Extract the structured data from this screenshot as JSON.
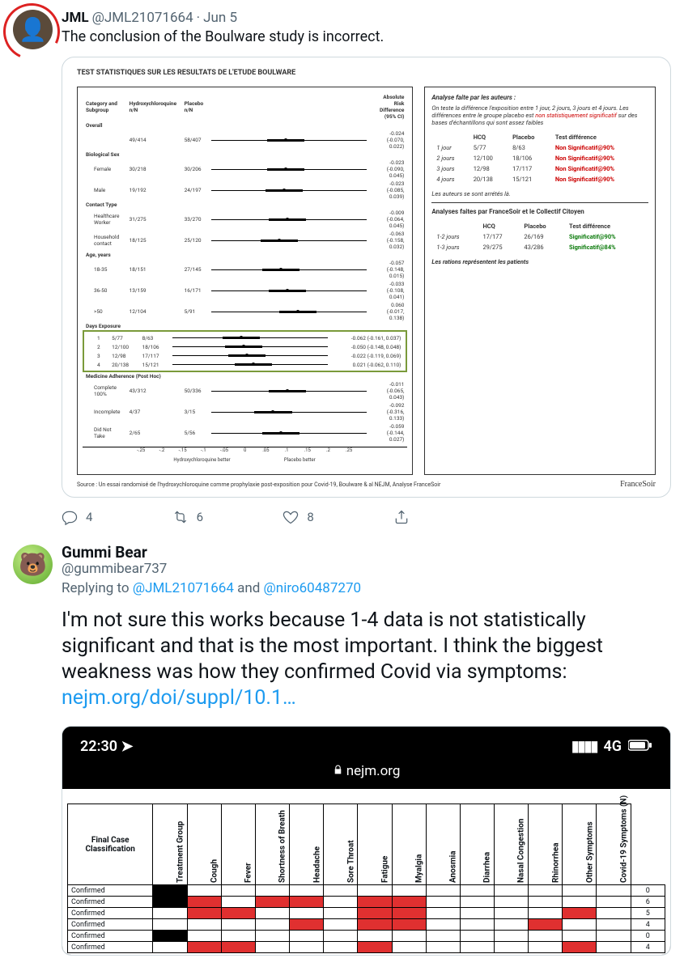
{
  "tweet1": {
    "display_name": "JML",
    "handle": "@JML21071664",
    "dot": "·",
    "timestamp": "Jun 5",
    "text": "The conclusion of the Boulware study is incorrect.",
    "actions": {
      "reply": "4",
      "retweet": "6",
      "like": "8"
    }
  },
  "forest": {
    "title": "TEST STATISTIQUES SUR LES RESULTATS DE L'ETUDE BOULWARE",
    "col_category": "Category and Subgroup",
    "col_hcq": "Hydroxychloroquine n/N",
    "col_placebo": "Placebo n/N",
    "col_ard": "Absolute Risk Difference (95% CI)",
    "groups": [
      {
        "cat": "Overall",
        "rows": [
          {
            "label": "",
            "hcq": "49/414",
            "plc": "58/407",
            "ard": "-0.024 (-0.070, 0.022)",
            "pos": 48
          }
        ]
      },
      {
        "cat": "Biological Sex",
        "rows": [
          {
            "label": "Female",
            "hcq": "30/218",
            "plc": "30/206",
            "ard": "-0.023 (-0.090, 0.045)",
            "pos": 48
          },
          {
            "label": "Male",
            "hcq": "19/192",
            "plc": "24/197",
            "ard": "-0.023 (-0.085, 0.039)",
            "pos": 47
          }
        ]
      },
      {
        "cat": "Contact Type",
        "rows": [
          {
            "label": "Healthcare Worker",
            "hcq": "31/275",
            "plc": "33/270",
            "ard": "-0.009 (-0.064, 0.045)",
            "pos": 49
          },
          {
            "label": "Household contact",
            "hcq": "18/125",
            "plc": "25/120",
            "ard": "-0.063 (-0.158, 0.032)",
            "pos": 44
          }
        ]
      },
      {
        "cat": "Age, years",
        "rows": [
          {
            "label": "18-35",
            "hcq": "18/151",
            "plc": "27/145",
            "ard": "-0.057 (-0.148, 0.015)",
            "pos": 45
          },
          {
            "label": "36-50",
            "hcq": "13/159",
            "plc": "16/171",
            "ard": "-0.033 (-0.108, 0.041)",
            "pos": 49
          },
          {
            "label": ">50",
            "hcq": "12/104",
            "plc": "5/91",
            "ard": "0.060 (-0.017, 0.138)",
            "pos": 56
          }
        ]
      },
      {
        "cat": "Days Exposure",
        "highlight": true,
        "rows": [
          {
            "label": "1",
            "hcq": "5/77",
            "plc": "8/63",
            "ard": "-0.062 (-0.161, 0.037)",
            "pos": 44
          },
          {
            "label": "2",
            "hcq": "12/100",
            "plc": "18/106",
            "ard": "-0.050 (-0.148, 0.048)",
            "pos": 46
          },
          {
            "label": "3",
            "hcq": "12/98",
            "plc": "17/117",
            "ard": "-0.022 (-0.119, 0.069)",
            "pos": 48
          },
          {
            "label": "4",
            "hcq": "20/138",
            "plc": "15/121",
            "ard": "0.021 (-0.062, 0.110)",
            "pos": 52
          }
        ]
      },
      {
        "cat": "Medicine Adherence (Post Hoc)",
        "rows": [
          {
            "label": "Complete 100%",
            "hcq": "43/312",
            "plc": "50/336",
            "ard": "-0.011 (-0.065, 0.043)",
            "pos": 49
          },
          {
            "label": "Incomplete",
            "hcq": "4/37",
            "plc": "3/15",
            "ard": "-0.092 (-0.316, 0.133)",
            "pos": 40
          },
          {
            "label": "Did Not Take",
            "hcq": "2/65",
            "plc": "5/56",
            "ard": "-0.059 (-0.144, 0.027)",
            "pos": 45
          }
        ]
      }
    ],
    "axis_left": "Hydroxychloroquine better",
    "axis_right": "Placebo better",
    "axis_ticks": [
      "-.25",
      "-.2",
      "-.15",
      "-.1",
      "-.05",
      "0",
      ".05",
      ".1",
      ".15",
      ".2",
      ".25"
    ]
  },
  "analysis": {
    "title1": "Analyse faite par les auteurs :",
    "intro1": "On teste la différence l'exposition entre 1 jour, 2 jours, 3 jours et 4 jours. Les différences entre le groupe placebo est ",
    "intro_red": "non statistiquement significatif",
    "intro2": " sur des bases d'échantillons qui sont assez faibles",
    "th_hcq": "HCQ",
    "th_plc": "Placebo",
    "th_diff": "Test différence",
    "rows1": [
      {
        "d": "1 jour",
        "hcq": "5/77",
        "plc": "8/63",
        "diff": "Non Significatif@90%"
      },
      {
        "d": "2 jours",
        "hcq": "12/100",
        "plc": "18/106",
        "diff": "Non Significatif@90%"
      },
      {
        "d": "3 jours",
        "hcq": "12/98",
        "plc": "17/117",
        "diff": "Non Significatif@90%"
      },
      {
        "d": "4 jours",
        "hcq": "20/138",
        "plc": "15/121",
        "diff": "Non Significatif@90%"
      }
    ],
    "note1": "Les auteurs se sont arrétés là.",
    "title2": "Analyses faites par FranceSoir et le Collectif Citoyen",
    "rows2": [
      {
        "d": "1-2 jours",
        "hcq": "17/177",
        "plc": "26/169",
        "diff": "Significatif@90%"
      },
      {
        "d": "1-3 jours",
        "hcq": "29/275",
        "plc": "43/286",
        "diff": "Significatif@84%"
      }
    ],
    "note2": "Les rations représentent les patients",
    "source": "Source : Un essai randomisé de l'hydroxychloroquine comme prophylaxie post-exposition pour Covid-19, Boulware & al NEJM, Analyse FranceSoir",
    "logo": "FranceSoir"
  },
  "tweet2": {
    "display_name": "Gummi Bear",
    "handle": "@gummibear737",
    "reply_prefix": "Replying to ",
    "mention1": "@JML21071664",
    "and": " and ",
    "mention2": "@niro60487270",
    "text": "I'm not sure this works because 1-4 data is not statistically significant and that is the most important. I think the biggest weakness was how they confirmed Covid via symptoms: ",
    "link": "nejm.org/doi/suppl/10.1…"
  },
  "phone": {
    "time": "22:30",
    "network": "4G",
    "url": "nejm.org",
    "row_header": "Final Case Classification",
    "columns": [
      "Treatment Group",
      "Cough",
      "Fever",
      "Shortness of Breath",
      "Headache",
      "Sore Throat",
      "Fatigue",
      "Myalgia",
      "Anosmia",
      "Diarrhea",
      "Nasal Congestion",
      "Rhinorrhea",
      "Other Symptoms",
      "Covid-19 Symptoms (N)"
    ],
    "rows": [
      {
        "label": "Confirmed",
        "cells": [
          "K",
          "",
          "",
          "",
          "",
          "",
          "",
          "",
          "",
          "",
          "",
          "",
          "",
          ""
        ],
        "n": "0"
      },
      {
        "label": "Confirmed",
        "cells": [
          "K",
          "R",
          "",
          "R",
          "R",
          "",
          "R",
          "R",
          "",
          "",
          "",
          "",
          "",
          ""
        ],
        "n": "6"
      },
      {
        "label": "Confirmed",
        "cells": [
          "",
          "R",
          "R",
          "",
          "",
          "",
          "R",
          "R",
          "",
          "",
          "",
          "",
          "R",
          ""
        ],
        "n": "5"
      },
      {
        "label": "Confirmed",
        "cells": [
          "",
          "",
          "",
          "",
          "R",
          "",
          "R",
          "R",
          "",
          "",
          "",
          "R",
          "",
          ""
        ],
        "n": "4"
      },
      {
        "label": "Confirmed",
        "cells": [
          "K",
          "",
          "",
          "",
          "",
          "",
          "",
          "",
          "",
          "",
          "",
          "",
          "",
          ""
        ],
        "n": "0"
      },
      {
        "label": "Confirmed",
        "cells": [
          "",
          "R",
          "R",
          "",
          "",
          "",
          "R",
          "",
          "",
          "",
          "",
          "",
          "R",
          ""
        ],
        "n": "4"
      }
    ]
  },
  "chart_data": {
    "type": "table",
    "title": "Forest plot + analysis comparison (Boulware HCQ study)",
    "note": "See forest.groups and analysis.rows1/rows2 for numeric values; phone.rows for symptom heatmap."
  }
}
